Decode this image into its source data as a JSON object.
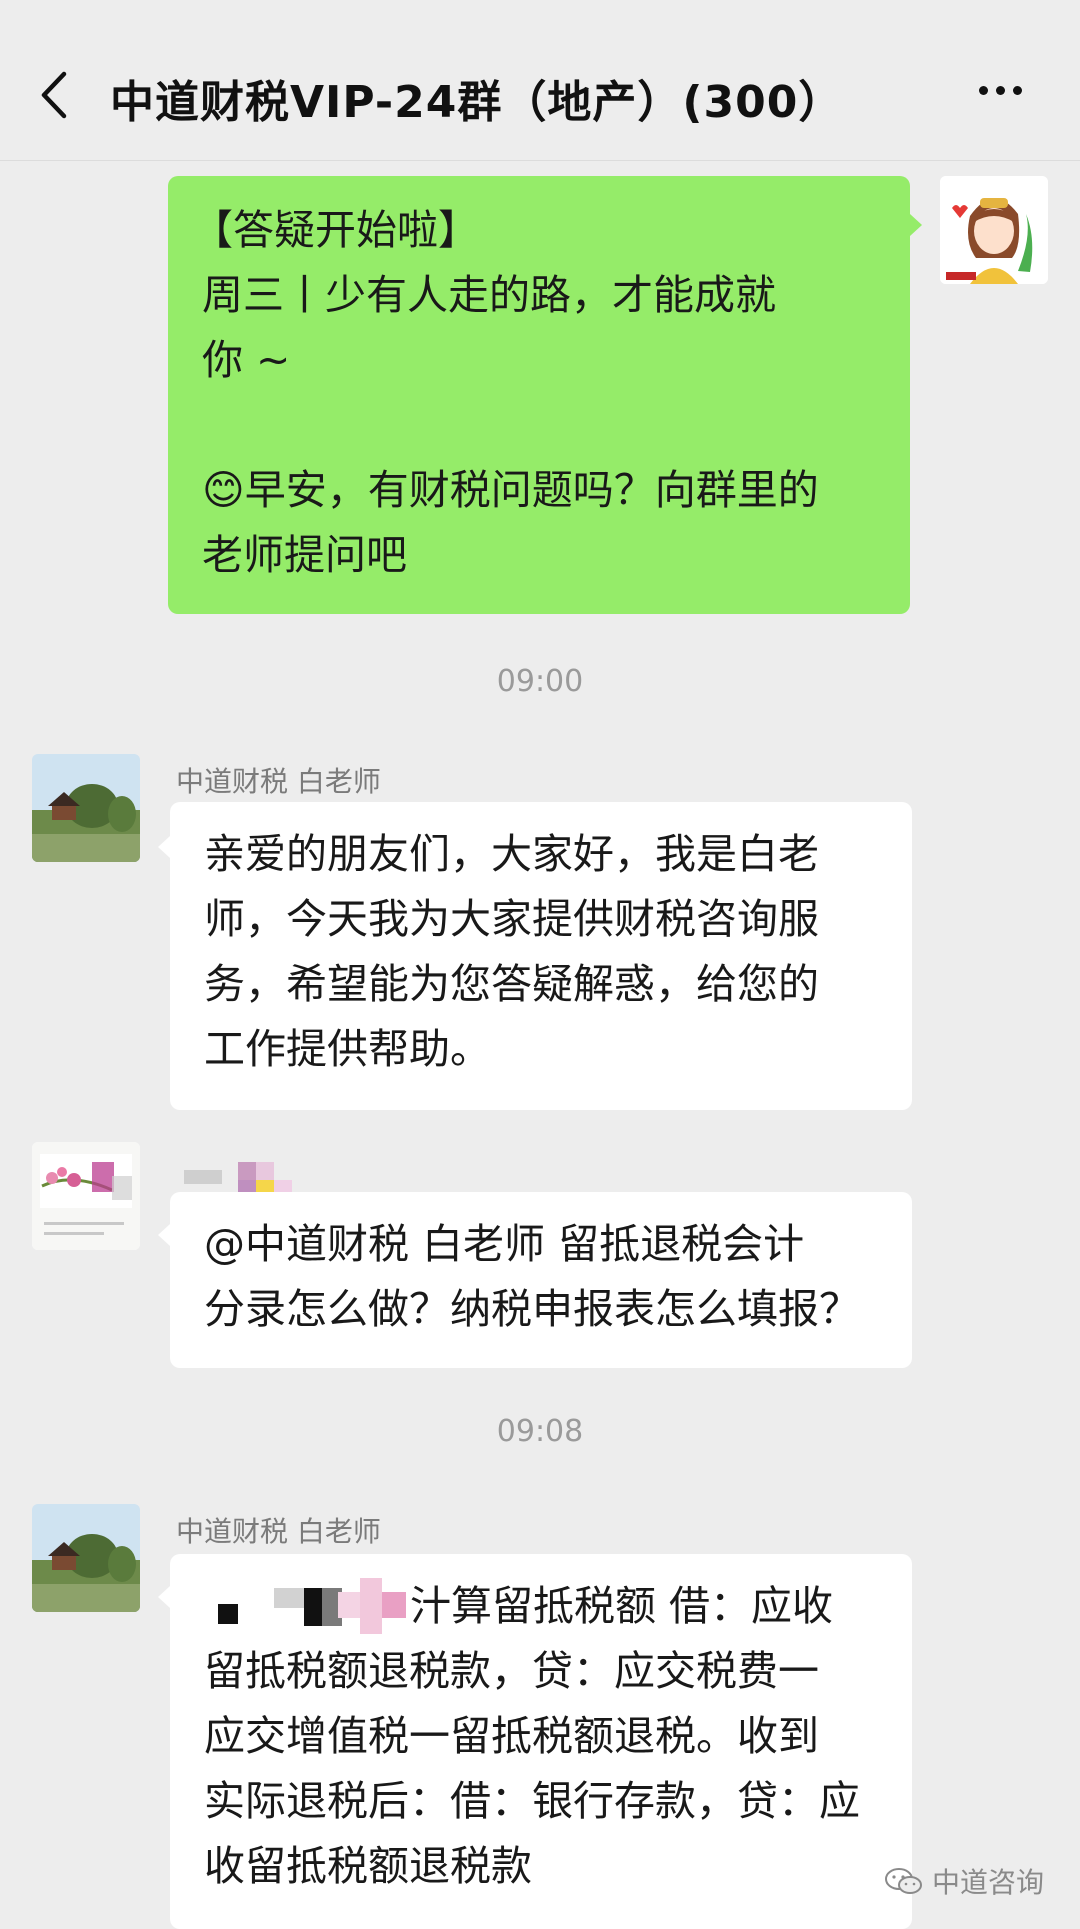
{
  "header": {
    "back_label": "<",
    "title": "中道财税VIP-24群（地产）(300）",
    "more_label": "..."
  },
  "messages": [
    {
      "type": "self",
      "avatar_icon": "cartoon-girl-avatar",
      "lines": [
        "【答疑开始啦】",
        "周三丨少有人走的路，才能成就",
        "你 ~",
        "",
        "😊早安，有财税问题吗？向群里的",
        "老师提问吧"
      ]
    },
    {
      "type": "time",
      "text": "09:00"
    },
    {
      "type": "other",
      "sender": "中道财税 白老师",
      "avatar_icon": "landscape-avatar",
      "lines": [
        "亲爱的朋友们，大家好，我是白老",
        "师，今天我为大家提供财税咨询服",
        "务，希望能为您答疑解惑，给您的",
        "工作提供帮助。"
      ]
    },
    {
      "type": "other",
      "sender": "",
      "avatar_icon": "flower-avatar",
      "lines": [
        "@中道财税 白老师  留抵退税会计",
        "分录怎么做？纳税申报表怎么填报？"
      ]
    },
    {
      "type": "time",
      "text": "09:08"
    },
    {
      "type": "other",
      "sender": "中道财税 白老师",
      "avatar_icon": "landscape-avatar",
      "lines": [
        "汁算留抵税额  借：应收",
        "留抵税额退税款，贷：应交税费一",
        "应交增值税一留抵税额退税。收到",
        "实际退税后：借：银行存款，贷：应",
        "收留抵税额退税款"
      ]
    }
  ],
  "watermark": {
    "text": "中道咨询",
    "icon": "wechat-icon"
  },
  "colors": {
    "background": "#ededed",
    "self_bubble": "#95ec69",
    "other_bubble": "#ffffff"
  }
}
